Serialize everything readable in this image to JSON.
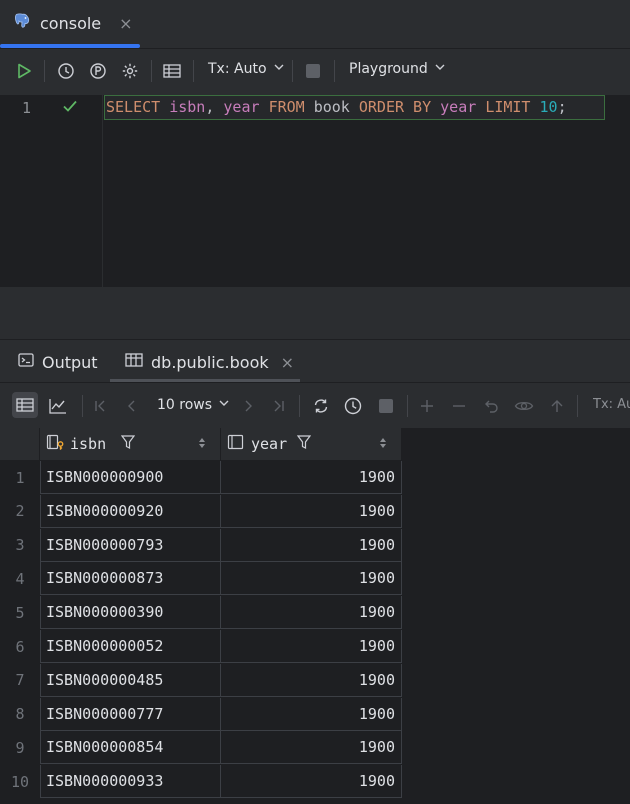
{
  "tabbar": {
    "console_label": "console",
    "close_glyph": "×"
  },
  "toolbar": {
    "tx_label": "Tx: Auto",
    "playground_label": "Playground",
    "icons": [
      "run-icon",
      "history-icon",
      "pin-p-icon",
      "settings-icon",
      "table-icon",
      "stop-icon"
    ]
  },
  "editor": {
    "line_number": "1",
    "tokens": [
      {
        "t": "SELECT",
        "c": "kw"
      },
      {
        "t": " ",
        "c": "pl"
      },
      {
        "t": "isbn",
        "c": "id"
      },
      {
        "t": ", ",
        "c": "pl"
      },
      {
        "t": "year",
        "c": "id"
      },
      {
        "t": " ",
        "c": "pl"
      },
      {
        "t": "FROM",
        "c": "kw"
      },
      {
        "t": " book ",
        "c": "pl"
      },
      {
        "t": "ORDER BY",
        "c": "kw"
      },
      {
        "t": " ",
        "c": "pl"
      },
      {
        "t": "year",
        "c": "id"
      },
      {
        "t": " ",
        "c": "pl"
      },
      {
        "t": "LIMIT",
        "c": "kw"
      },
      {
        "t": " ",
        "c": "pl"
      },
      {
        "t": "10",
        "c": "num"
      },
      {
        "t": ";",
        "c": "pl"
      }
    ]
  },
  "results": {
    "tabs": {
      "output_label": "Output",
      "table_label": "db.public.book",
      "close_glyph": "×"
    },
    "toolbar": {
      "rows_label": "10 rows",
      "tx_label": "Tx: Au"
    },
    "columns": [
      "isbn",
      "year"
    ],
    "rows": [
      {
        "n": "1",
        "isbn": "ISBN000000900",
        "year": "1900"
      },
      {
        "n": "2",
        "isbn": "ISBN000000920",
        "year": "1900"
      },
      {
        "n": "3",
        "isbn": "ISBN000000793",
        "year": "1900"
      },
      {
        "n": "4",
        "isbn": "ISBN000000873",
        "year": "1900"
      },
      {
        "n": "5",
        "isbn": "ISBN000000390",
        "year": "1900"
      },
      {
        "n": "6",
        "isbn": "ISBN000000052",
        "year": "1900"
      },
      {
        "n": "7",
        "isbn": "ISBN000000485",
        "year": "1900"
      },
      {
        "n": "8",
        "isbn": "ISBN000000777",
        "year": "1900"
      },
      {
        "n": "9",
        "isbn": "ISBN000000854",
        "year": "1900"
      },
      {
        "n": "10",
        "isbn": "ISBN000000933",
        "year": "1900"
      }
    ]
  }
}
